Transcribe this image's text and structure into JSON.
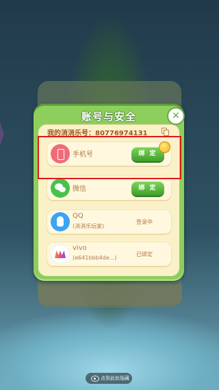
{
  "dialog": {
    "title": "账号与安全",
    "account_label": "我的消消乐号：80776974131",
    "rows": [
      {
        "label": "手机号",
        "action": "绑 定",
        "icon": "phone-icon"
      },
      {
        "label": "微信",
        "action": "绑 定",
        "icon": "wechat-icon"
      },
      {
        "label": "QQ",
        "sub": "(消消乐玩家)",
        "status": "登录中",
        "icon": "qq-icon"
      },
      {
        "label": "vivo",
        "sub": "(e641bbb4de...)",
        "status": "已绑定",
        "icon": "vivo-icon"
      }
    ]
  },
  "bottom_hint": {
    "text": "点到此处隐藏",
    "icon": "eye-icon"
  },
  "colors": {
    "dialog_green": "#8dcf5c",
    "panel_cream": "#fbf1c8",
    "bind_green": "#3f9e2b",
    "highlight_red": "#e01818"
  }
}
